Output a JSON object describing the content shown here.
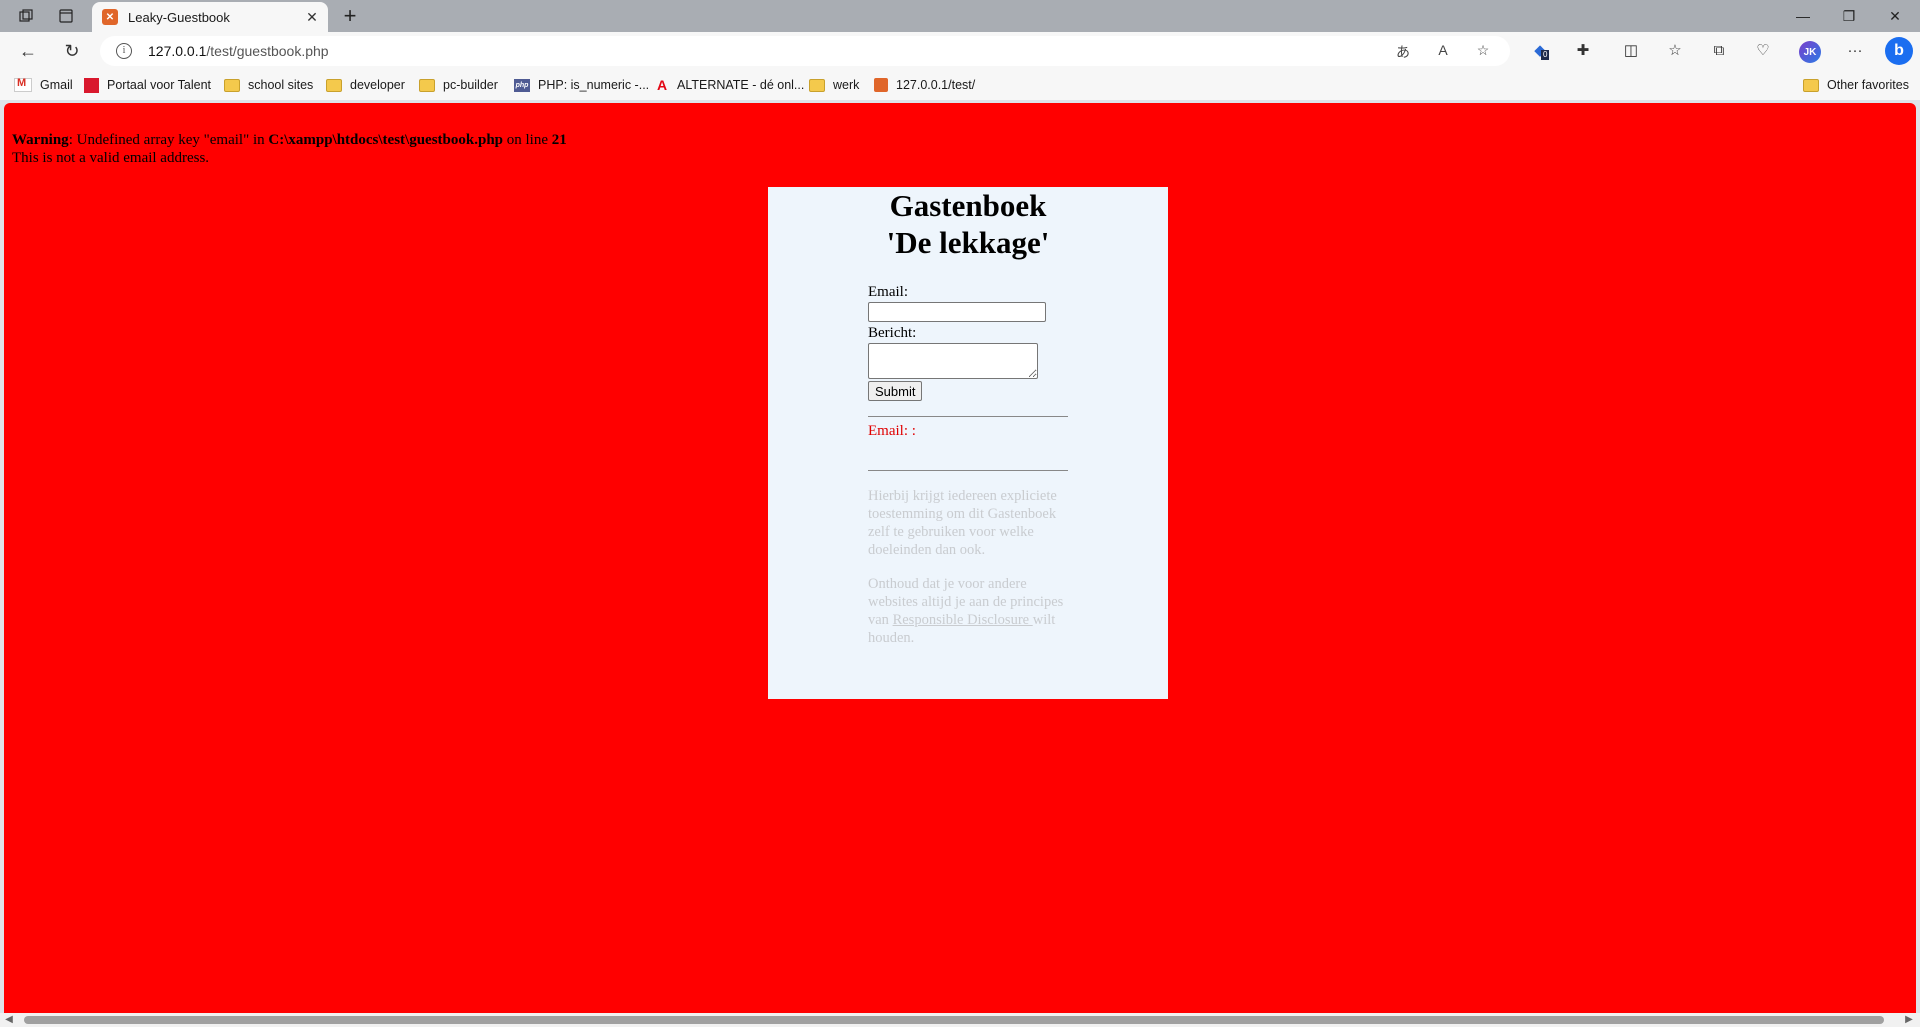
{
  "browser": {
    "tab": {
      "title": "Leaky-Guestbook",
      "favicon": "xampp-icon"
    },
    "address": {
      "host": "127.0.0.1",
      "path": "/test/guestbook.php"
    },
    "profile_initials": "JK",
    "extension_badge": "0",
    "bookmarks": [
      {
        "label": "Gmail",
        "icon": "gmail-icon"
      },
      {
        "label": "Portaal voor Talent",
        "icon": "portaal-icon"
      },
      {
        "label": "school sites",
        "icon": "folder-icon"
      },
      {
        "label": "developer",
        "icon": "folder-icon"
      },
      {
        "label": "pc-builder",
        "icon": "folder-icon"
      },
      {
        "label": "PHP: is_numeric -...",
        "icon": "php-icon"
      },
      {
        "label": "ALTERNATE - dé onl...",
        "icon": "alternate-icon"
      },
      {
        "label": "werk",
        "icon": "folder-icon"
      },
      {
        "label": "127.0.0.1/test/",
        "icon": "xampp-icon"
      }
    ],
    "other_favorites": "Other favorites"
  },
  "page": {
    "background": "#ff0000",
    "warning": {
      "label": "Warning",
      "text_a": ": Undefined array key \"email\" in ",
      "file": "C:\\xampp\\htdocs\\test\\guestbook.php",
      "text_b": " on line ",
      "line": "21"
    },
    "error_message": "This is not a valid email address.",
    "title_line1": "Gastenboek",
    "title_line2": "'De lekkage'",
    "form": {
      "email_label": "Email:",
      "message_label": "Bericht:",
      "submit_label": "Submit"
    },
    "entry": "Email: :",
    "footer": {
      "p1": "Hierbij krijgt iedereen expliciete toestemming om dit Gastenboek zelf te gebruiken voor welke doeleinden dan ook.",
      "p2_a": "Onthoud dat je voor andere websites altijd je aan de principes van ",
      "p2_link": "Responsible Disclosure ",
      "p2_b": "wilt houden."
    }
  }
}
